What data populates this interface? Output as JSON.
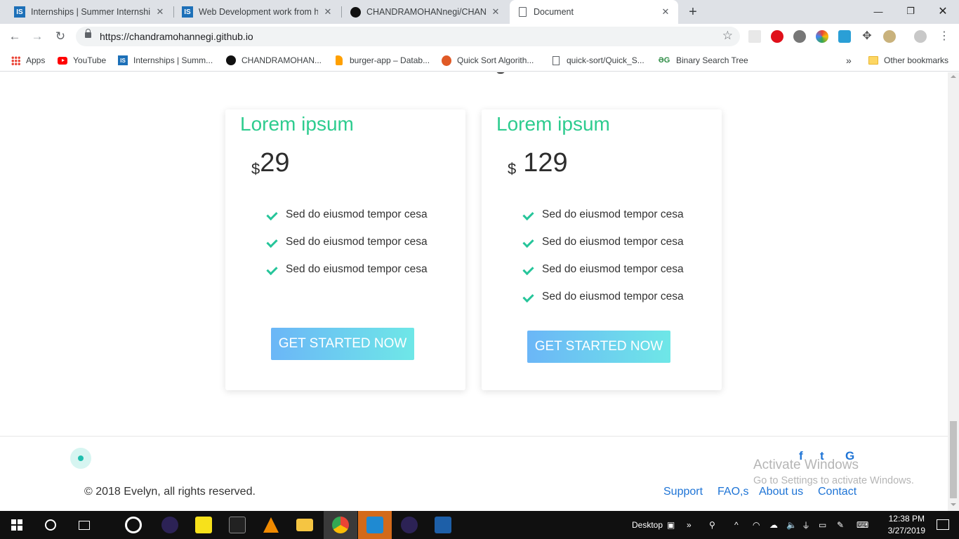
{
  "browser": {
    "tabs": [
      {
        "title": "Internships | Summer Internship",
        "icon": "internshala-icon",
        "active": false
      },
      {
        "title": "Web Development work from ho",
        "icon": "internshala-icon",
        "active": false
      },
      {
        "title": "CHANDRAMOHANnegi/CHANDI",
        "icon": "github-icon",
        "active": false
      },
      {
        "title": "Document",
        "icon": "document-icon",
        "active": true
      }
    ],
    "url": "https://chandramohannegi.github.io",
    "bookmarks": [
      {
        "label": "Apps",
        "icon": "apps-grid-icon"
      },
      {
        "label": "YouTube",
        "icon": "youtube-icon"
      },
      {
        "label": "Internships | Summ...",
        "icon": "internshala-icon"
      },
      {
        "label": "CHANDRAMOHAN...",
        "icon": "github-icon"
      },
      {
        "label": "burger-app – Datab...",
        "icon": "firebase-icon"
      },
      {
        "label": "Quick Sort Algorith...",
        "icon": "geeks-icon"
      },
      {
        "label": "quick-sort/Quick_S...",
        "icon": "page-icon"
      },
      {
        "label": "Binary Search Tree",
        "icon": "gfg-icon"
      }
    ],
    "bookmarks_overflow": "»",
    "other_bookmarks": "Other bookmarks"
  },
  "pricing": {
    "cards": [
      {
        "title": "Lorem ipsum",
        "currency": "$",
        "amount": "29",
        "features": [
          "Sed do eiusmod tempor cesa",
          "Sed do eiusmod tempor cesa",
          "Sed do eiusmod tempor cesa"
        ],
        "cta": "GET STARTED NOW"
      },
      {
        "title": "Lorem ipsum",
        "currency": "$",
        "amount": "129",
        "features": [
          "Sed do eiusmod tempor cesa",
          "Sed do eiusmod tempor cesa",
          "Sed do eiusmod tempor cesa",
          "Sed do eiusmod tempor cesa"
        ],
        "cta": "GET STARTED NOW"
      }
    ]
  },
  "footer": {
    "copyright": "© 2018 Evelyn, all rights reserved.",
    "social": [
      "f",
      "t",
      "G"
    ],
    "links": [
      "Support",
      "FAO,s",
      "About us",
      "Contact"
    ]
  },
  "watermark": {
    "title": "Activate Windows",
    "subtitle": "Go to Settings to activate Windows."
  },
  "taskbar": {
    "desktop_label": "Desktop",
    "time": "12:38 PM",
    "date": "3/27/2019"
  },
  "colors": {
    "accent_green": "#2ecc8f",
    "link_blue": "#1e74d6",
    "button_gradient_start": "#6bb6f7",
    "button_gradient_end": "#6ee7e7"
  }
}
